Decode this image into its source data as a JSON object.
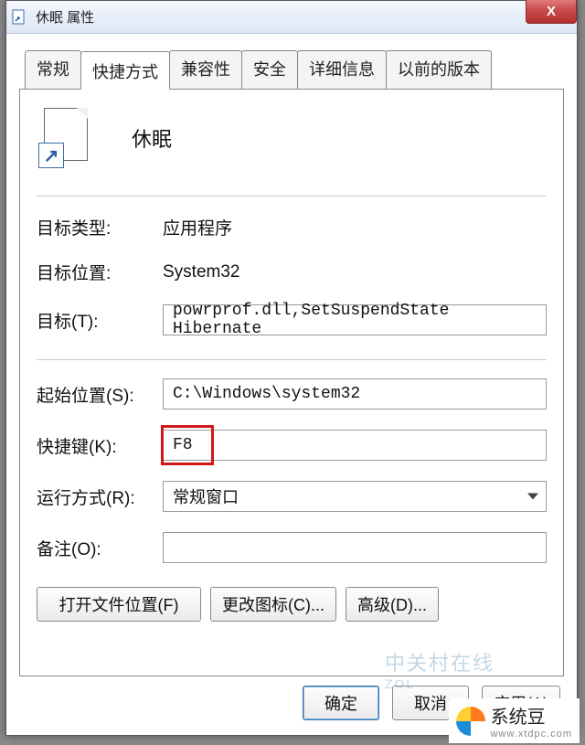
{
  "titlebar": {
    "icon_name": "shortcut-icon",
    "title": "休眠 属性"
  },
  "tabs": {
    "items": [
      "常规",
      "快捷方式",
      "兼容性",
      "安全",
      "详细信息",
      "以前的版本"
    ],
    "active_index": 1
  },
  "header": {
    "title": "休眠"
  },
  "fields": {
    "target_type": {
      "label": "目标类型:",
      "value": "应用程序"
    },
    "target_loc": {
      "label": "目标位置:",
      "value": "System32"
    },
    "target": {
      "label": "目标(T):",
      "value": "powrprof.dll,SetSuspendState Hibernate"
    },
    "start_in": {
      "label": "起始位置(S):",
      "value": "C:\\Windows\\system32"
    },
    "shortcut_key": {
      "label": "快捷键(K):",
      "value": "F8"
    },
    "run": {
      "label": "运行方式(R):",
      "value": "常规窗口"
    },
    "comment": {
      "label": "备注(O):",
      "value": ""
    }
  },
  "buttons": {
    "open_file_location": "打开文件位置(F)",
    "change_icon": "更改图标(C)...",
    "advanced": "高级(D)..."
  },
  "footer": {
    "ok": "确定",
    "cancel": "取消",
    "apply": "应用(A)"
  },
  "watermark": {
    "main": "中关村在线",
    "sub": "ZOL"
  },
  "brand": {
    "name": "系统豆",
    "sub": "www.xtdpc.com"
  }
}
